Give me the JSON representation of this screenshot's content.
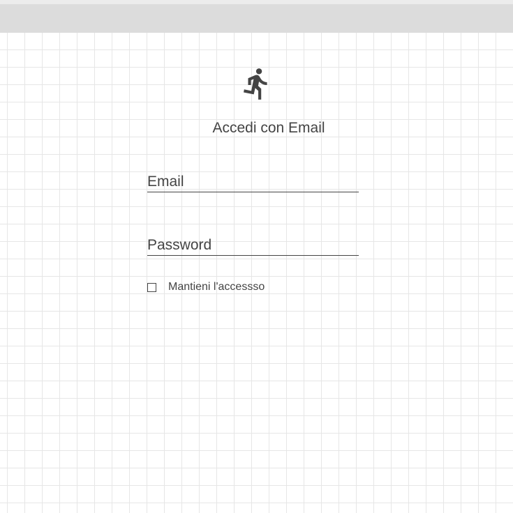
{
  "login": {
    "icon": "run-icon",
    "title": "Accedi con Email",
    "email": {
      "placeholder": "Email",
      "value": ""
    },
    "password": {
      "placeholder": "Password",
      "value": ""
    },
    "remember": {
      "label": "Mantieni l'accessso",
      "checked": false
    }
  },
  "colors": {
    "text": "#444444",
    "top_bar": "#dcdcdc",
    "grid_line": "#e6e6e6",
    "background": "#ffffff"
  }
}
